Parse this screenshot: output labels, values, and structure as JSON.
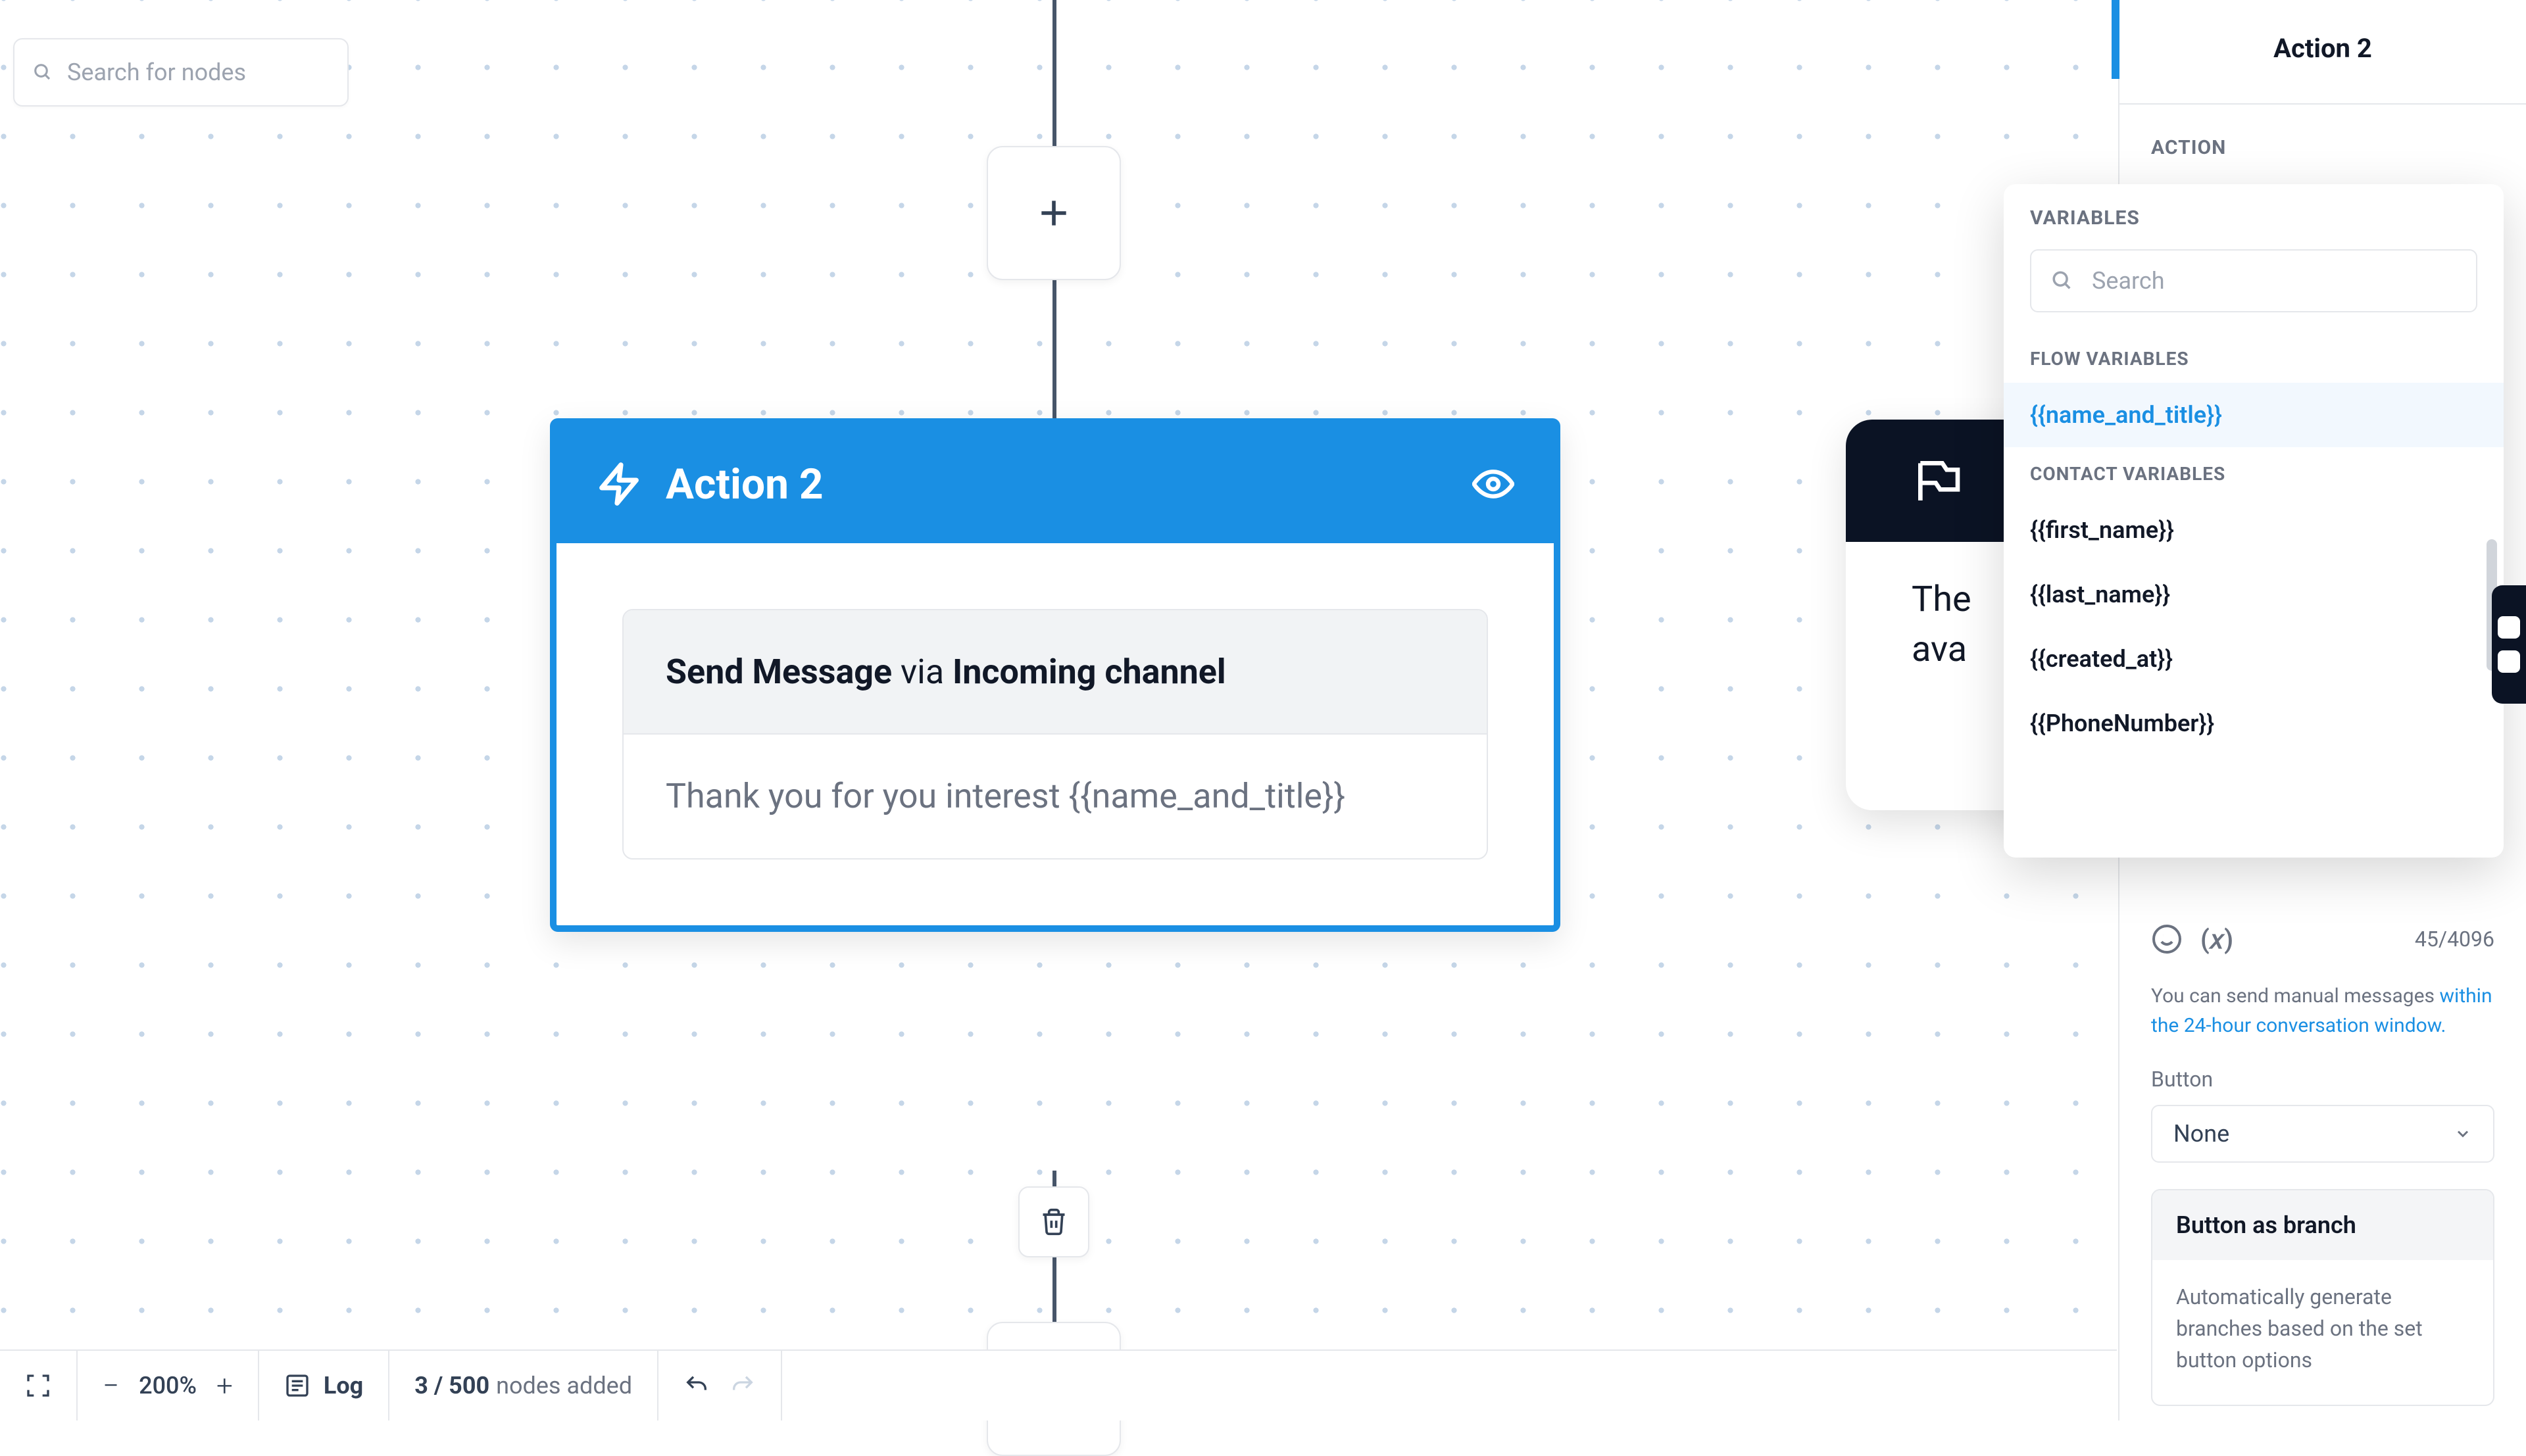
{
  "search": {
    "placeholder": "Search for nodes"
  },
  "node": {
    "title": "Action 2",
    "message_action": "Send Message",
    "message_via": " via ",
    "message_channel": "Incoming channel",
    "message_body": "Thank you for you interest {{name_and_title}}"
  },
  "peek": {
    "line1": "The",
    "line2": "ava"
  },
  "sidebar": {
    "title": "Action 2",
    "section_action": "ACTION",
    "char_count": "45/4096",
    "helper_prefix": "You can send manual messages ",
    "helper_link": "within the 24-hour conversation window.",
    "button_label": "Button",
    "button_value": "None",
    "branch_title": "Button as branch",
    "branch_desc": "Automatically generate branches based on the set button options"
  },
  "variables": {
    "title": "VARIABLES",
    "search_placeholder": "Search",
    "group_flow": "FLOW VARIABLES",
    "group_contact": "CONTACT VARIABLES",
    "flow": [
      "{{name_and_title}}"
    ],
    "contact": [
      "{{first_name}}",
      "{{last_name}}",
      "{{created_at}}",
      "{{PhoneNumber}}"
    ]
  },
  "bottombar": {
    "zoom": "200%",
    "log": "Log",
    "nodes_count": "3 / 500",
    "nodes_label": "nodes added"
  }
}
